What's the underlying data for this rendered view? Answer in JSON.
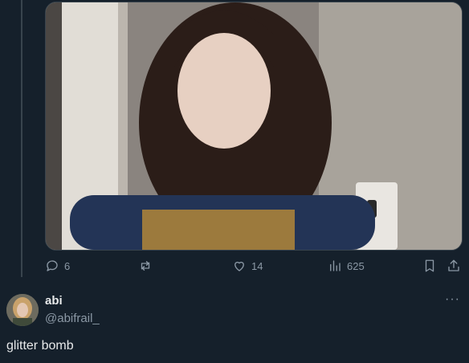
{
  "colors": {
    "background": "#15202b",
    "muted": "#8b98a5",
    "text": "#e7e9ea"
  },
  "actions": {
    "replies": {
      "icon": "reply-icon",
      "count": "6"
    },
    "retweets": {
      "icon": "retweet-icon",
      "count": ""
    },
    "likes": {
      "icon": "heart-icon",
      "count": "14"
    },
    "views": {
      "icon": "analytics-icon",
      "count": "625"
    },
    "bookmark": {
      "icon": "bookmark-icon"
    },
    "share": {
      "icon": "share-icon"
    }
  },
  "reply_tweet": {
    "name": "abi",
    "handle": "@abifrail_",
    "more": "···",
    "text": "glitter bomb"
  }
}
